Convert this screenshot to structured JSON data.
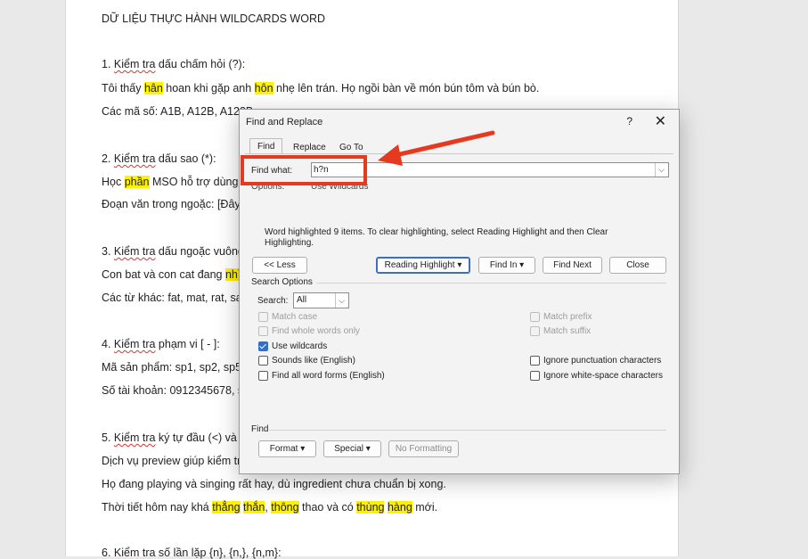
{
  "document": {
    "title": "DỮ LIỆU THỰC HÀNH WILDCARDS WORD",
    "lines": [
      [
        {
          "t": "1. "
        },
        {
          "t": "Kiểm tra",
          "sq": true
        },
        {
          "t": " dấu chấm hỏi (?):"
        }
      ],
      [
        {
          "t": "Tôi thấy "
        },
        {
          "t": "hân",
          "hl": true
        },
        {
          "t": " hoan khi gặp anh "
        },
        {
          "t": "hôn",
          "hl": true
        },
        {
          "t": " nhẹ lên trán. Họ ngồi bàn về món bún tôm và bún bò."
        }
      ],
      [
        {
          "t": "Các mã số: A1B, A12B, A123B."
        }
      ],
      [
        {
          "t": "2. "
        },
        {
          "t": "Kiểm tra",
          "sq": true
        },
        {
          "t": " dấu sao (*):"
        }
      ],
      [
        {
          "t": "Học "
        },
        {
          "t": "phần",
          "hl": true
        },
        {
          "t": " MSO hỗ trợ dùng M"
        }
      ],
      [
        {
          "t": "Đoạn văn trong ngoặc: [Đây l"
        }
      ],
      [
        {
          "t": "3. "
        },
        {
          "t": "Kiểm tra",
          "sq": true
        },
        {
          "t": " dấu ngoặc vuông"
        }
      ],
      [
        {
          "t": "Con bat và con cat đang "
        },
        {
          "t": "nhì",
          "hl": true
        }
      ],
      [
        {
          "t": "Các từ khác: fat, mat, rat, sa"
        }
      ],
      [
        {
          "t": "4. "
        },
        {
          "t": "Kiểm tra",
          "sq": true
        },
        {
          "t": " phạm vi [ - ]:"
        }
      ],
      [
        {
          "t": "Mã sản phẩm: sp1, sp2, sp5,"
        }
      ],
      [
        {
          "t": "Số tài khoản: 0912345678, s"
        }
      ],
      [
        {
          "t": "5. "
        },
        {
          "t": "Kiểm tra",
          "sq": true
        },
        {
          "t": " ký tự đầu (<) và cu"
        }
      ],
      [
        {
          "t": "Dịch vụ preview giúp kiểm tra"
        }
      ],
      [
        {
          "t": "Họ đang playing và singing rất hay, dù ingredient chưa chuẩn bị xong."
        }
      ],
      [
        {
          "t": "Thời tiết hôm nay khá "
        },
        {
          "t": "thẳng",
          "hl": true
        },
        {
          "t": " "
        },
        {
          "t": "thắn",
          "hl": true
        },
        {
          "t": ", "
        },
        {
          "t": "thông",
          "hl": true
        },
        {
          "t": " thao và có "
        },
        {
          "t": "thùng",
          "hl": true
        },
        {
          "t": " "
        },
        {
          "t": "hàng",
          "hl": true
        },
        {
          "t": " mới."
        }
      ],
      [
        {
          "t": "6. "
        },
        {
          "t": "Kiểm tra",
          "sq": true
        },
        {
          "t": " số lần lặp {n}, {n,}, {n,m}:"
        }
      ]
    ]
  },
  "dialog": {
    "title": "Find and Replace",
    "help": "?",
    "close": "✕",
    "tabs": [
      "Find",
      "Replace",
      "Go To"
    ],
    "find_label": "Find what:",
    "find_value": "h?n",
    "options_label": "Options:",
    "options_value": "Use Wildcards",
    "info": "Word highlighted 9 items. To clear highlighting, select Reading Highlight and then Clear Highlighting.",
    "buttons": {
      "less": "<< Less",
      "reading_highlight": "Reading Highlight ▾",
      "find_in": "Find In ▾",
      "find_next": "Find Next",
      "close": "Close"
    },
    "search_options_label": "Search Options",
    "search_label": "Search:",
    "search_value": "All",
    "checkboxes_left": [
      {
        "label": "Match case",
        "checked": false,
        "disabled": true
      },
      {
        "label": "Find whole words only",
        "checked": false,
        "disabled": true
      },
      {
        "label": "Use wildcards",
        "checked": true,
        "disabled": false
      },
      {
        "label": "Sounds like (English)",
        "checked": false,
        "disabled": false
      },
      {
        "label": "Find all word forms (English)",
        "checked": false,
        "disabled": false
      }
    ],
    "checkboxes_right": [
      {
        "label": "Match prefix",
        "checked": false,
        "disabled": true
      },
      {
        "label": "Match suffix",
        "checked": false,
        "disabled": true
      },
      {
        "label": "Ignore punctuation characters",
        "checked": false,
        "disabled": false
      },
      {
        "label": "Ignore white-space characters",
        "checked": false,
        "disabled": false
      }
    ],
    "find_section_label": "Find",
    "format_btn": "Format ▾",
    "special_btn": "Special ▾",
    "no_formatting_btn": "No Formatting"
  },
  "annotation_color": "#e53a1f"
}
